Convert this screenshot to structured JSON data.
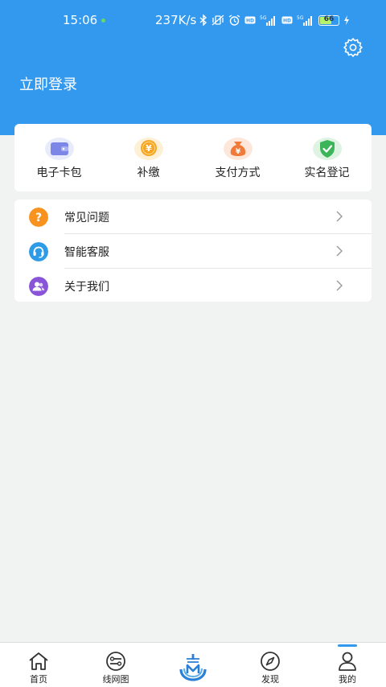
{
  "status_bar": {
    "time": "15:06",
    "speed": "237K/s",
    "battery": "66",
    "icons": [
      "bluetooth-icon",
      "vibrate-off-icon",
      "alarm-icon",
      "hd-icon",
      "signal-5g-icon",
      "hd-icon",
      "signal-5g-icon",
      "battery-icon",
      "charging-icon"
    ]
  },
  "header": {
    "login": "立即登录",
    "settings_icon": "gear-icon",
    "background": "#3399ee"
  },
  "quick_actions": [
    {
      "label": "电子卡包",
      "icon": "wallet-icon",
      "color": "#7b86e6"
    },
    {
      "label": "补缴",
      "icon": "yen-coin-icon",
      "color": "#f5a623"
    },
    {
      "label": "支付方式",
      "icon": "money-bag-icon",
      "color": "#f07a3a"
    },
    {
      "label": "实名登记",
      "icon": "shield-check-icon",
      "color": "#3cb55a"
    }
  ],
  "menu": [
    {
      "label": "常见问题",
      "icon": "question-icon",
      "color": "#f7931e"
    },
    {
      "label": "智能客服",
      "icon": "headset-icon",
      "color": "#2d9be8"
    },
    {
      "label": "关于我们",
      "icon": "people-icon",
      "color": "#8a54d8"
    }
  ],
  "tabbar": {
    "tabs": [
      {
        "label": "首页",
        "icon": "home-icon"
      },
      {
        "label": "线网图",
        "icon": "route-map-icon"
      },
      {
        "label": "",
        "icon": "metro-logo-icon"
      },
      {
        "label": "发现",
        "icon": "compass-icon"
      },
      {
        "label": "我的",
        "icon": "user-icon"
      }
    ],
    "active": "我的",
    "accent": "#3399ee"
  }
}
